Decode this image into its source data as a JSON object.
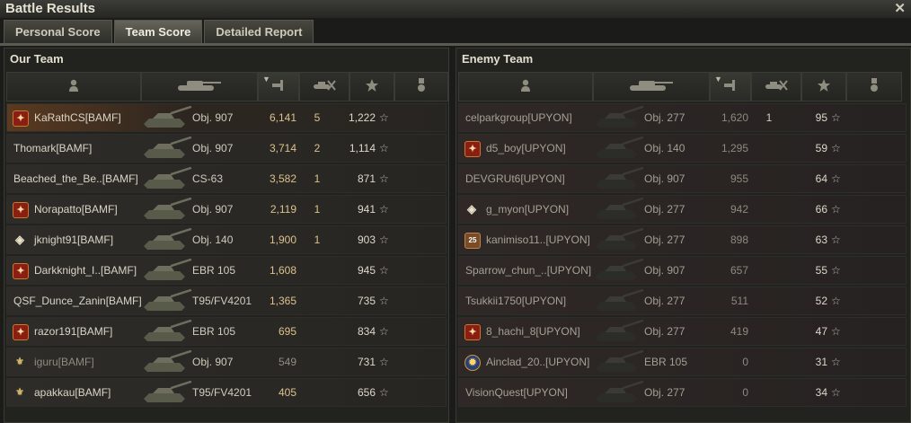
{
  "window": {
    "title": "Battle Results"
  },
  "tabs": [
    "Personal Score",
    "Team Score",
    "Detailed Report"
  ],
  "active_tab": 1,
  "colors": {
    "highlight": "#5a3a20",
    "damage_text": "#dcc28b"
  },
  "our_team": {
    "title": "Our Team",
    "players": [
      {
        "name": "KaRathCS[BAMF]",
        "badge": "red",
        "tank": "Obj. 907",
        "damage": "6,141",
        "kills": "5",
        "xp": "1,222",
        "me": true
      },
      {
        "name": "Thomark[BAMF]",
        "badge": "",
        "tank": "Obj. 907",
        "damage": "3,714",
        "kills": "2",
        "xp": "1,114"
      },
      {
        "name": "Beached_the_Be..[BAMF]",
        "badge": "",
        "tank": "CS-63",
        "damage": "3,582",
        "kills": "1",
        "xp": "871"
      },
      {
        "name": "Norapatto[BAMF]",
        "badge": "red",
        "tank": "Obj. 907",
        "damage": "2,119",
        "kills": "1",
        "xp": "941"
      },
      {
        "name": "jknight91[BAMF]",
        "badge": "diamond",
        "tank": "Obj. 140",
        "damage": "1,900",
        "kills": "1",
        "xp": "903"
      },
      {
        "name": "Darkknight_I..[BAMF]",
        "badge": "red",
        "tank": "EBR 105",
        "damage": "1,608",
        "kills": "",
        "xp": "945"
      },
      {
        "name": "QSF_Dunce_Zanin[BAMF]",
        "badge": "",
        "tank": "T95/FV4201",
        "damage": "1,365",
        "kills": "",
        "xp": "735"
      },
      {
        "name": "razor191[BAMF]",
        "badge": "red",
        "tank": "EBR 105",
        "damage": "695",
        "kills": "",
        "xp": "834"
      },
      {
        "name": "iguru[BAMF]",
        "badge": "eagle",
        "tank": "Obj. 907",
        "damage": "549",
        "kills": "",
        "xp": "731",
        "dead": true
      },
      {
        "name": "apakkau[BAMF]",
        "badge": "eagle",
        "tank": "T95/FV4201",
        "damage": "405",
        "kills": "",
        "xp": "656"
      }
    ]
  },
  "enemy_team": {
    "title": "Enemy Team",
    "players": [
      {
        "name": "celparkgroup[UPYON]",
        "badge": "",
        "tank": "Obj. 277",
        "damage": "1,620",
        "kills": "1",
        "xp": "95"
      },
      {
        "name": "d5_boy[UPYON]",
        "badge": "red",
        "tank": "Obj. 140",
        "damage": "1,295",
        "kills": "",
        "xp": "59"
      },
      {
        "name": "DEVGRUt6[UPYON]",
        "badge": "",
        "tank": "Obj. 907",
        "damage": "955",
        "kills": "",
        "xp": "64"
      },
      {
        "name": "g_myon[UPYON]",
        "badge": "diamond",
        "tank": "Obj. 277",
        "damage": "942",
        "kills": "",
        "xp": "66"
      },
      {
        "name": "kanimiso11..[UPYON]",
        "badge": "lv",
        "badge_text": "25",
        "tank": "Obj. 277",
        "damage": "898",
        "kills": "",
        "xp": "63"
      },
      {
        "name": "Sparrow_chun_..[UPYON]",
        "badge": "",
        "tank": "Obj. 907",
        "damage": "657",
        "kills": "",
        "xp": "55"
      },
      {
        "name": "Tsukkii1750[UPYON]",
        "badge": "",
        "tank": "Obj. 277",
        "damage": "511",
        "kills": "",
        "xp": "52"
      },
      {
        "name": "8_hachi_8[UPYON]",
        "badge": "red",
        "tank": "Obj. 277",
        "damage": "419",
        "kills": "",
        "xp": "47"
      },
      {
        "name": "Ainclad_20..[UPYON]",
        "badge": "blue",
        "tank": "EBR 105",
        "damage": "0",
        "kills": "",
        "xp": "31"
      },
      {
        "name": "VisionQuest[UPYON]",
        "badge": "",
        "tank": "Obj. 277",
        "damage": "0",
        "kills": "",
        "xp": "34"
      }
    ]
  },
  "header_icons": [
    "player-icon",
    "tank-icon",
    "damage-icon",
    "kills-icon",
    "xp-star-icon",
    "medal-icon"
  ]
}
